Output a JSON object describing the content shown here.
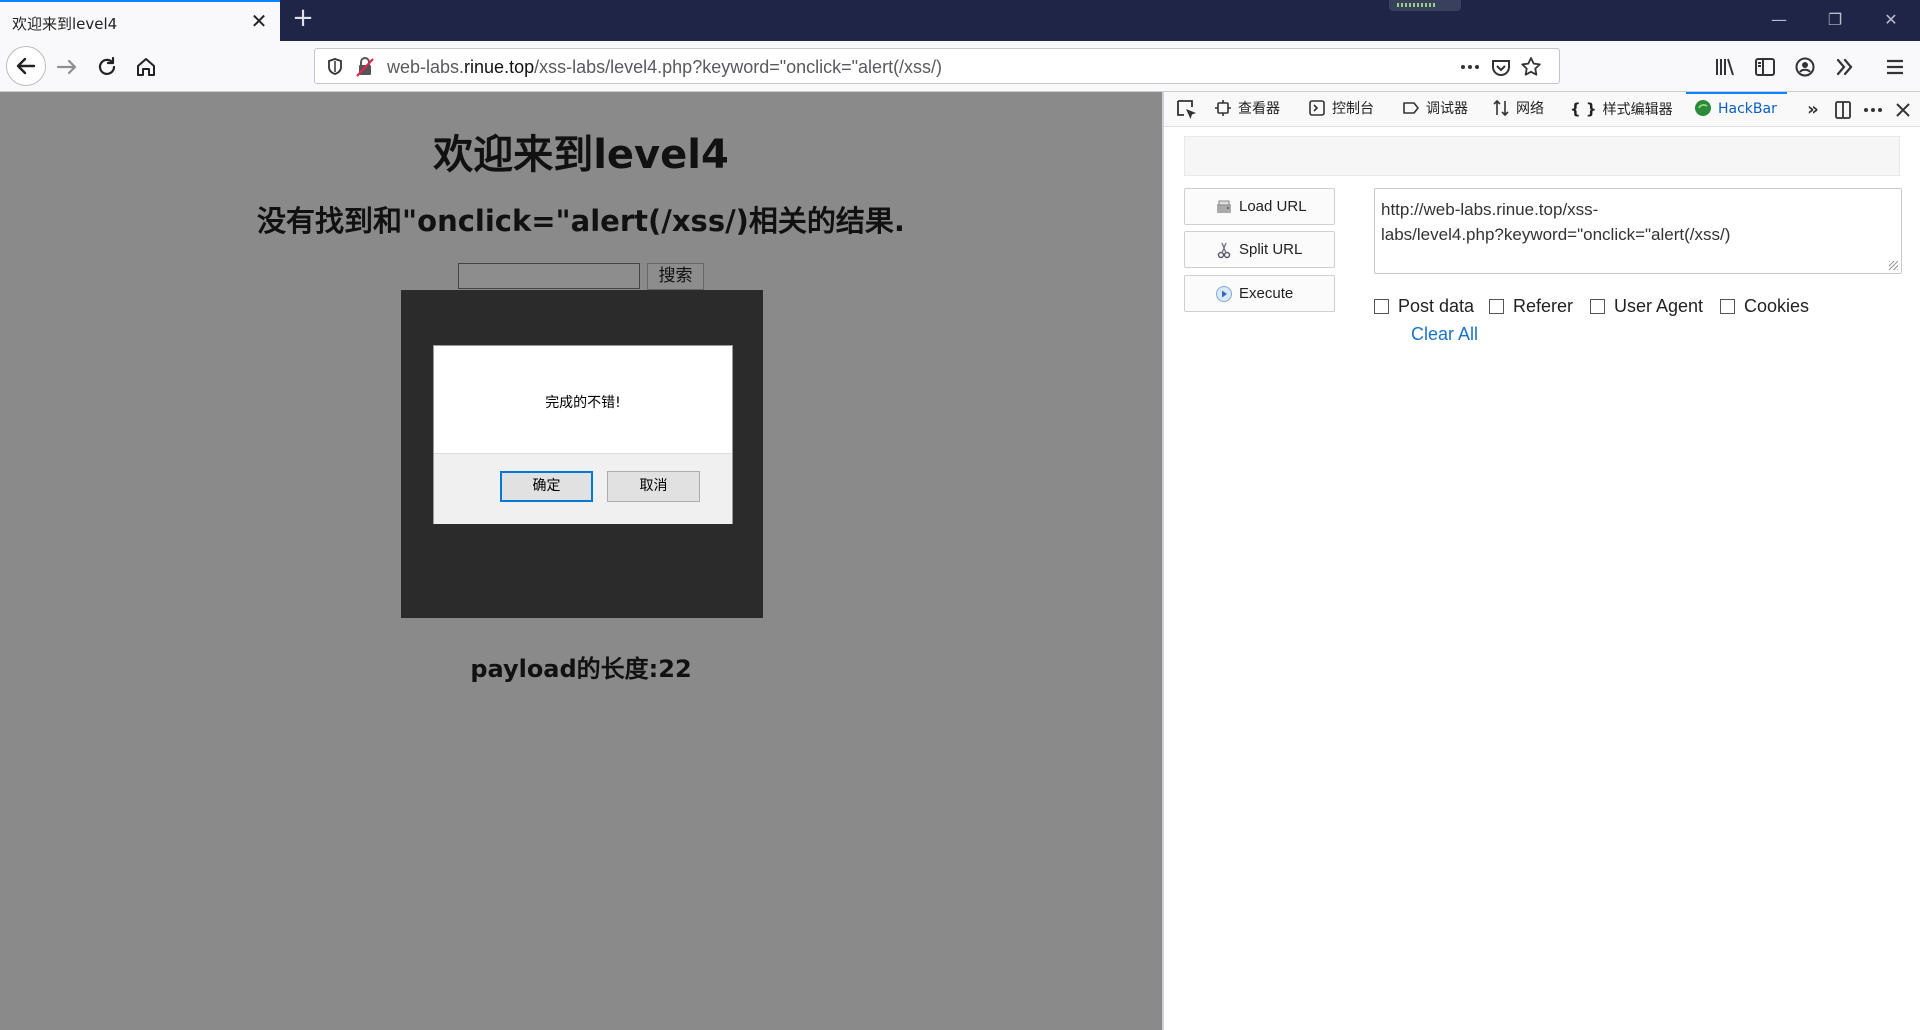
{
  "browser": {
    "tab_title": "欢迎来到level4",
    "tab_close": "✕",
    "new_tab": "+",
    "url_host_prefix": "web-labs.",
    "url_host_main": "rinue.top",
    "url_path": "/xss-labs/level4.php?keyword=\"onclick=\"alert(/xss/)",
    "window_controls": [
      "—",
      "❐",
      "✕"
    ]
  },
  "page": {
    "heading": "欢迎来到level4",
    "result_text": "没有找到和\"onclick=\"alert(/xss/)相关的结果.",
    "search_button": "搜索",
    "search_value": "",
    "payload_length": "payload的长度:22"
  },
  "alert": {
    "message": "完成的不错!",
    "ok_label": "确定",
    "cancel_label": "取消"
  },
  "devtools": {
    "tabs": [
      {
        "label": "查看器",
        "icon": "inspector-icon"
      },
      {
        "label": "控制台",
        "icon": "console-icon"
      },
      {
        "label": "调试器",
        "icon": "debugger-icon"
      },
      {
        "label": "网络",
        "icon": "network-icon"
      },
      {
        "label": "样式编辑器",
        "icon": "style-editor-icon"
      },
      {
        "label": "HackBar",
        "icon": "hackbar-icon",
        "active": true
      }
    ],
    "accent_color": "#0a84ff"
  },
  "hackbar": {
    "load_url": "Load URL",
    "split_url": "Split URL",
    "execute": "Execute",
    "url_value": "http://web-labs.rinue.top/xss-labs/level4.php?keyword=\"onclick=\"alert(/xss/)",
    "url_line1": "http://web-labs.rinue.top/xss-",
    "url_line2": "labs/level4.php?keyword=\"onclick=\"alert(/xss/)",
    "options": [
      "Post data",
      "Referer",
      "User Agent",
      "Cookies"
    ],
    "clear_all": "Clear All"
  }
}
